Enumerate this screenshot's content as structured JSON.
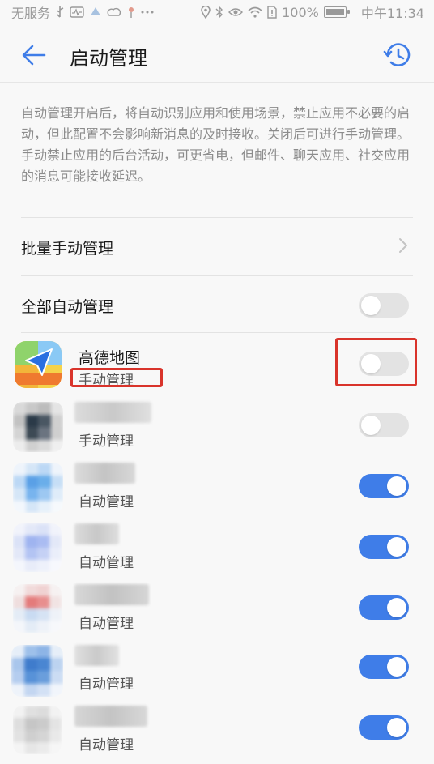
{
  "status_bar": {
    "carrier": "无服务",
    "battery": "100%",
    "time": "中午11:34"
  },
  "header": {
    "title": "启动管理",
    "back_icon": "arrow-left-icon",
    "history_icon": "history-clock-icon"
  },
  "description": {
    "line1": "自动管理开启后，将自动识别应用和使用场景，禁止应用不必要的启动，但此配置不会影响新消息的及时接收。关闭后可进行手动管理。",
    "line2": "手动禁止应用的后台活动，可更省电，但邮件、聊天应用、社交应用的消息可能接收延迟。"
  },
  "settings": {
    "batch_manual": "批量手动管理",
    "all_auto": "全部自动管理",
    "all_auto_on": false
  },
  "apps": [
    {
      "name": "高德地图",
      "mode": "手动管理",
      "enabled": false,
      "icon": "amap-icon"
    },
    {
      "name": "",
      "mode": "手动管理",
      "enabled": false,
      "icon": "blurred-app-icon"
    },
    {
      "name": "",
      "mode": "自动管理",
      "enabled": true,
      "icon": "blurred-app-icon"
    },
    {
      "name": "",
      "mode": "自动管理",
      "enabled": true,
      "icon": "blurred-app-icon"
    },
    {
      "name": "",
      "mode": "自动管理",
      "enabled": true,
      "icon": "blurred-app-icon"
    },
    {
      "name": "",
      "mode": "自动管理",
      "enabled": true,
      "icon": "blurred-app-icon"
    },
    {
      "name": "",
      "mode": "自动管理",
      "enabled": true,
      "icon": "blurred-app-icon"
    }
  ],
  "colors": {
    "accent": "#3f7de8",
    "annotation": "#d9342b",
    "toggle_off": "#e3e3e3"
  }
}
